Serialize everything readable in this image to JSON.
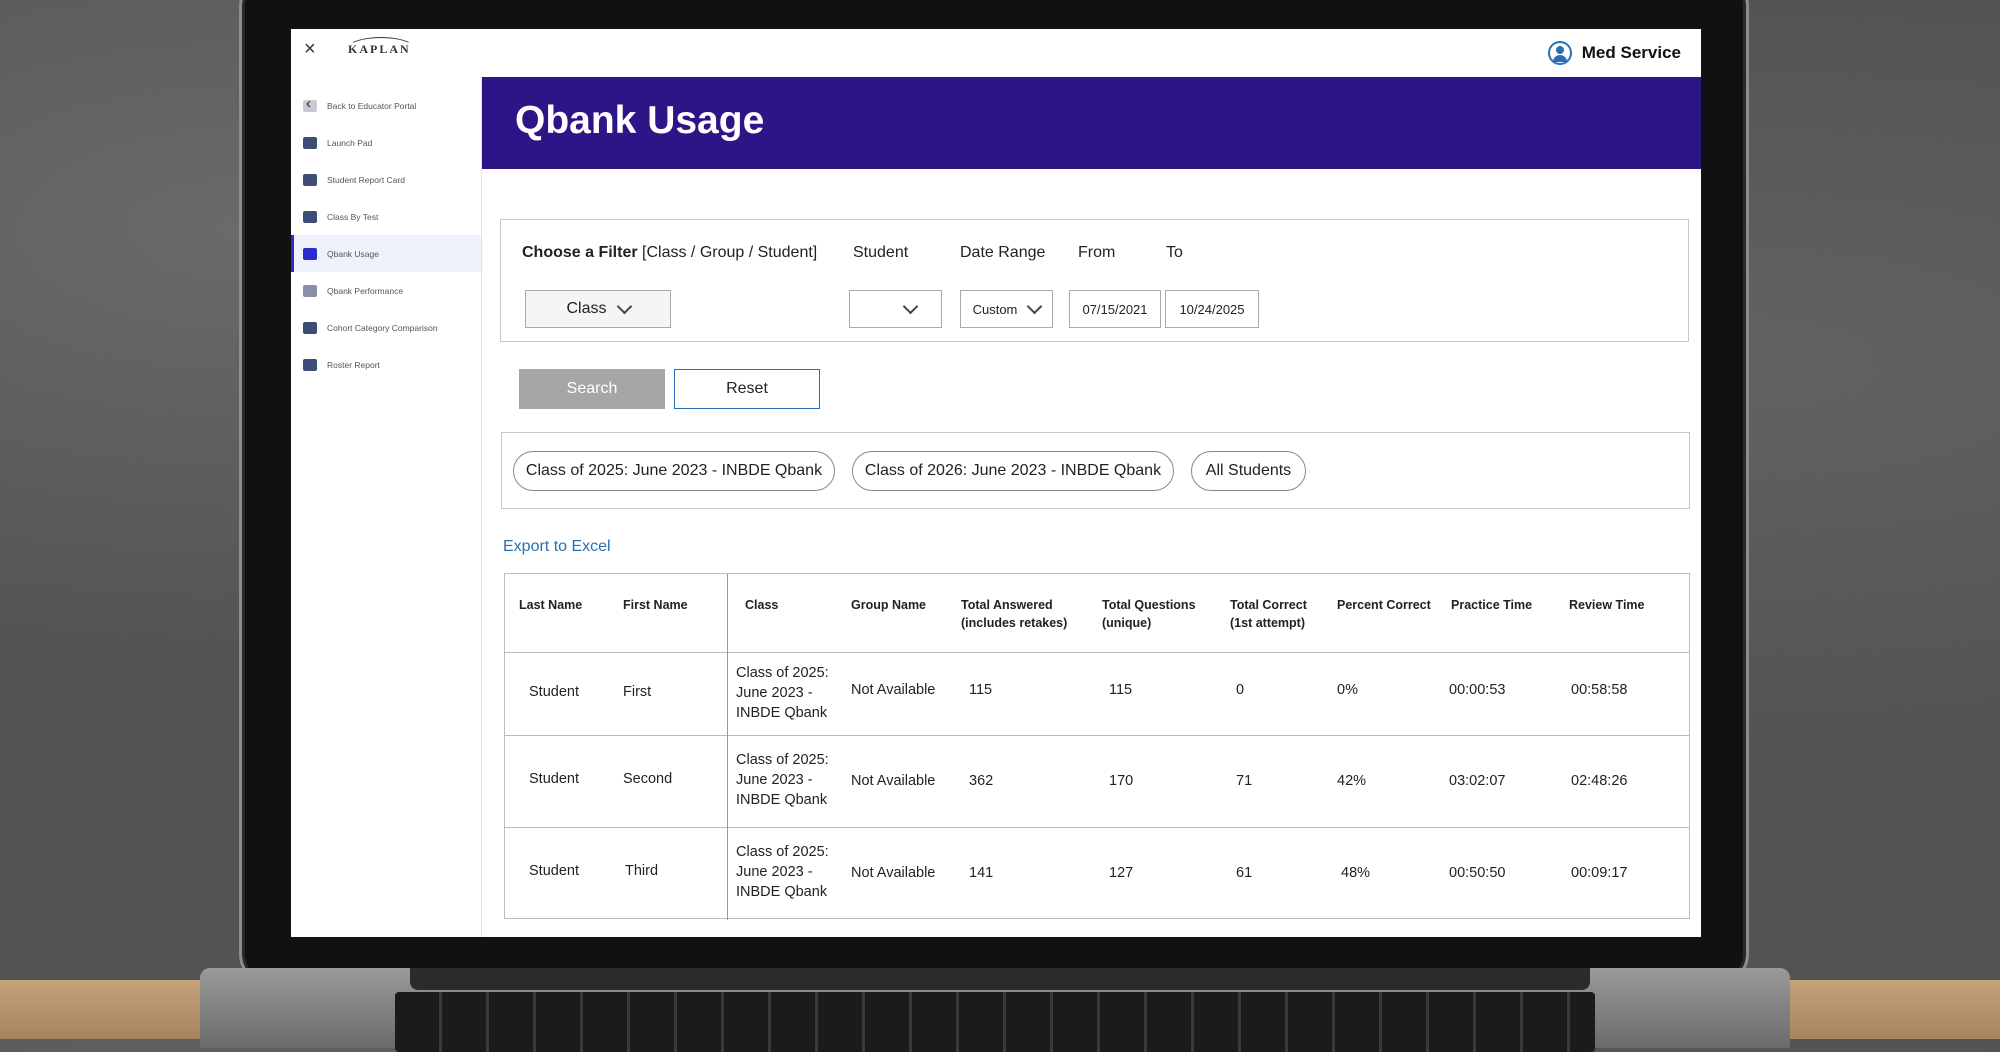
{
  "header": {
    "close_glyph": "×",
    "logo_text": "KAPLAN",
    "user_name": "Med Service"
  },
  "sidebar": {
    "items": [
      {
        "label": "Back to Educator Portal",
        "icon": "back-arrow-icon"
      },
      {
        "label": "Launch Pad",
        "icon": "rocket-icon"
      },
      {
        "label": "Student Report Card",
        "icon": "report-card-icon"
      },
      {
        "label": "Class By Test",
        "icon": "class-test-icon"
      },
      {
        "label": "Qbank Usage",
        "icon": "qbank-usage-icon",
        "active": true
      },
      {
        "label": "Qbank Performance",
        "icon": "qbank-performance-icon"
      },
      {
        "label": "Cohort Category Comparison",
        "icon": "cohort-comparison-icon"
      },
      {
        "label": "Roster Report",
        "icon": "roster-icon"
      }
    ]
  },
  "page": {
    "title": "Qbank Usage"
  },
  "filters": {
    "choose_label": "Choose a Filter",
    "choose_hint": "[Class / Group / Student]",
    "student_label": "Student",
    "date_range_label": "Date Range",
    "from_label": "From",
    "to_label": "To",
    "filter_value": "Class",
    "student_value": "",
    "date_range_value": "Custom",
    "from_value": "07/15/2021",
    "to_value": "10/24/2025"
  },
  "actions": {
    "search_label": "Search",
    "reset_label": "Reset"
  },
  "pills": [
    "Class of 2025: June 2023 - INBDE Qbank",
    "Class of 2026: June 2023 - INBDE Qbank",
    "All Students"
  ],
  "export_label": "Export to Excel",
  "table": {
    "headers": {
      "last_name": "Last Name",
      "first_name": "First Name",
      "class": "Class",
      "group_name": "Group Name",
      "total_answered_1": "Total Answered",
      "total_answered_2": "(includes retakes)",
      "total_questions_1": "Total Questions",
      "total_questions_2": "(unique)",
      "total_correct_1": "Total Correct",
      "total_correct_2": "(1st attempt)",
      "percent_correct": "Percent Correct",
      "practice_time": "Practice Time",
      "review_time": "Review Time"
    },
    "rows": [
      {
        "last": "Student",
        "first": "First",
        "class": "Class of 2025: June 2023 - INBDE Qbank",
        "group": "Not Available",
        "answered": "115",
        "questions": "115",
        "correct": "0",
        "percent": "0%",
        "practice": "00:00:53",
        "review": "00:58:58"
      },
      {
        "last": "Student",
        "first": "Second",
        "class": "Class of 2025: June 2023 - INBDE Qbank",
        "group": "Not Available",
        "answered": "362",
        "questions": "170",
        "correct": "71",
        "percent": "42%",
        "practice": "03:02:07",
        "review": "02:48:26"
      },
      {
        "last": "Student",
        "first": "Third",
        "class": "Class of 2025: June 2023 - INBDE Qbank",
        "group": "Not Available",
        "answered": "141",
        "questions": "127",
        "correct": "61",
        "percent": "48%",
        "practice": "00:50:50",
        "review": "00:09:17"
      }
    ]
  }
}
